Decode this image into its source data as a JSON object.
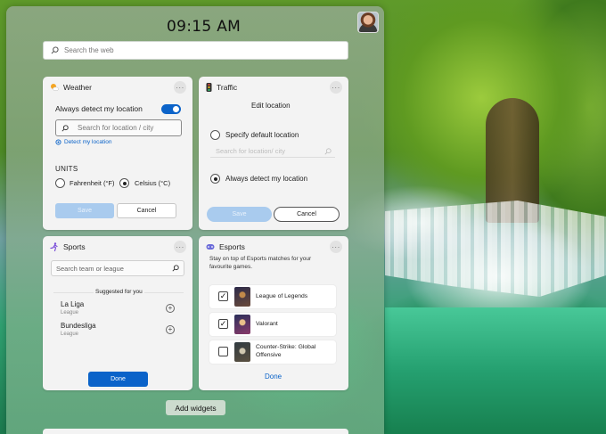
{
  "header": {
    "time": "09:15 AM"
  },
  "search": {
    "placeholder": "Search the web"
  },
  "weather": {
    "title": "Weather",
    "more": "···",
    "toggle_label": "Always detect my location",
    "city_placeholder": "Search for location / city",
    "detect_link": "Detect my location",
    "units_heading": "UNITS",
    "unit_f": "Fahrenheit (°F)",
    "unit_c": "Celsius (°C)",
    "save": "Save",
    "cancel": "Cancel"
  },
  "traffic": {
    "title": "Traffic",
    "more": "···",
    "edit_heading": "Edit location",
    "option_default": "Specify default location",
    "location_placeholder": "Search for location/ city",
    "option_detect": "Always detect my location",
    "save": "Save",
    "cancel": "Cancel"
  },
  "sports": {
    "title": "Sports",
    "more": "···",
    "search_placeholder": "Search team or league",
    "suggested_heading": "Suggested for you",
    "items": [
      {
        "name": "La Liga",
        "sub": "League"
      },
      {
        "name": "Bundesliga",
        "sub": "League"
      }
    ],
    "done": "Done"
  },
  "esports": {
    "title": "Esports",
    "more": "···",
    "description": "Stay on top of Esports matches for your favourite games.",
    "games": [
      {
        "name": "League of Legends",
        "checked": true,
        "check": "✓"
      },
      {
        "name": "Valorant",
        "checked": true,
        "check": "✓"
      },
      {
        "name": "Counter-Strike: Global Offensive",
        "checked": false,
        "check": ""
      }
    ],
    "done": "Done"
  },
  "footer": {
    "add_widgets": "Add widgets"
  }
}
